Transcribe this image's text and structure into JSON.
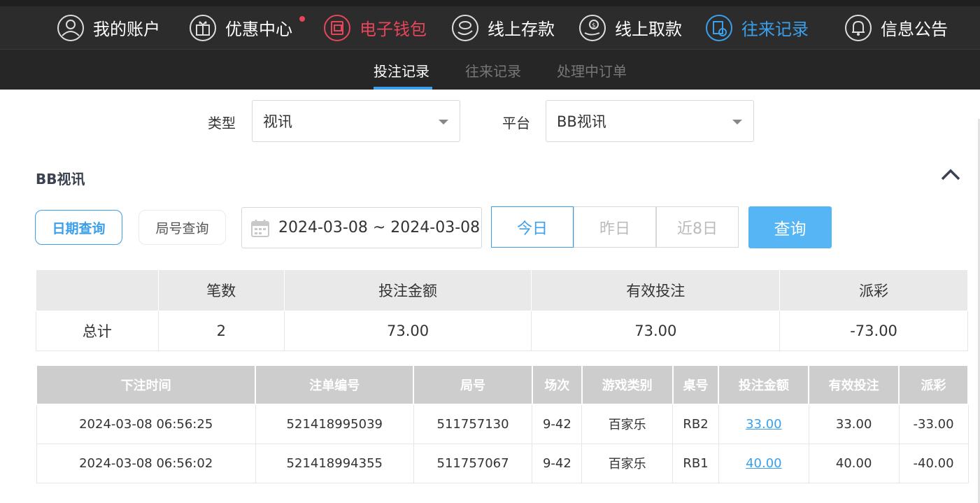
{
  "nav": {
    "items": [
      {
        "label": "我的账户",
        "icon": "user-icon"
      },
      {
        "label": "优惠中心",
        "icon": "gift-icon"
      },
      {
        "label": "电子钱包",
        "icon": "wallet-icon"
      },
      {
        "label": "线上存款",
        "icon": "deposit-icon"
      },
      {
        "label": "线上取款",
        "icon": "withdraw-icon"
      },
      {
        "label": "往来记录",
        "icon": "records-icon"
      },
      {
        "label": "信息公告",
        "icon": "bell-icon"
      }
    ]
  },
  "subnav": {
    "tabs": [
      "投注记录",
      "往来记录",
      "处理中订单"
    ]
  },
  "filters": {
    "type_label": "类型",
    "type_value": "视讯",
    "platform_label": "平台",
    "platform_value": "BB视讯"
  },
  "section": {
    "title": "BB视讯"
  },
  "query": {
    "date_mode": "日期查询",
    "round_mode": "局号查询",
    "date_range": "2024-03-08 ~ 2024-03-08",
    "today": "今日",
    "yesterday": "昨日",
    "last8": "近8日",
    "submit": "查询"
  },
  "summary": {
    "headers": [
      "",
      "笔数",
      "投注金额",
      "有效投注",
      "派彩"
    ],
    "row": {
      "label": "总计",
      "count": "2",
      "bet": "73.00",
      "valid": "73.00",
      "payout": "-73.00"
    }
  },
  "details": {
    "headers": [
      "下注时间",
      "注单编号",
      "局号",
      "场次",
      "游戏类别",
      "桌号",
      "投注金额",
      "有效投注",
      "派彩"
    ],
    "rows": [
      {
        "time": "2024-03-08 06:56:25",
        "order": "521418995039",
        "round": "511757130",
        "session": "9-42",
        "game": "百家乐",
        "table": "RB2",
        "bet": "33.00",
        "valid": "33.00",
        "payout": "-33.00"
      },
      {
        "time": "2024-03-08 06:56:02",
        "order": "521418994355",
        "round": "511757067",
        "session": "9-42",
        "game": "百家乐",
        "table": "RB1",
        "bet": "40.00",
        "valid": "40.00",
        "payout": "-40.00"
      }
    ]
  },
  "colors": {
    "accent": "#3aa0ec",
    "active_wallet": "#e8445a",
    "negative": "#e8445a"
  }
}
